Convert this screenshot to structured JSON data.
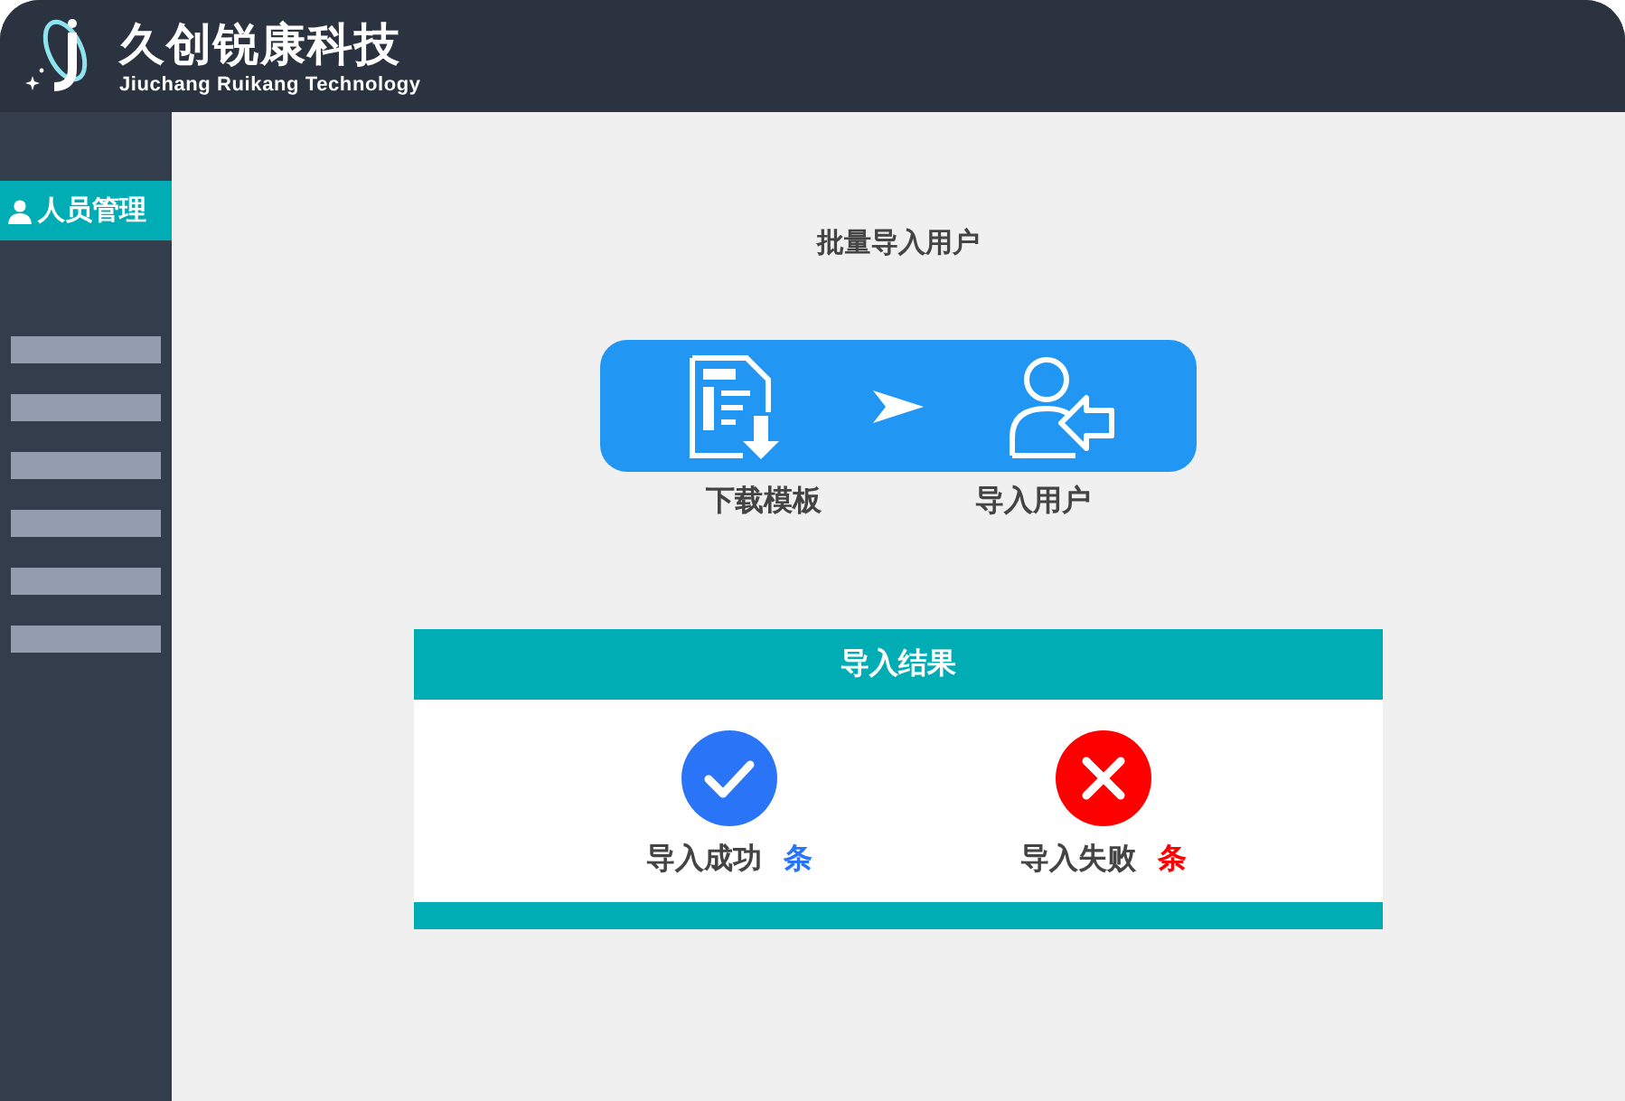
{
  "header": {
    "brand": "久创锐康科技",
    "subtitle": "Jiuchang Ruikang Technology"
  },
  "sidebar": {
    "items": [
      {
        "label": "人员管理",
        "selected": true
      }
    ]
  },
  "page_title": "批量导入用户",
  "steps": [
    {
      "label": "下载模板",
      "kind": "download"
    },
    {
      "label": "导入用户",
      "kind": "import"
    }
  ],
  "results": {
    "title": "导入结果",
    "items": [
      {
        "label": "导入成功",
        "unit": "条",
        "kind": "success",
        "color": "#2a75f7"
      },
      {
        "label": "导入失败",
        "unit": "条",
        "kind": "fail",
        "color": "#ff0000"
      }
    ]
  }
}
